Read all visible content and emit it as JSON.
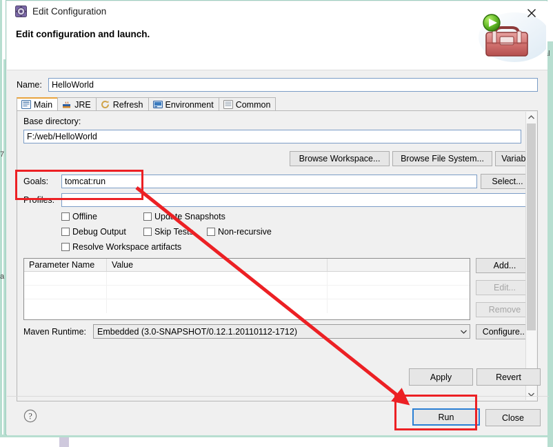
{
  "window": {
    "title": "Edit Configuration",
    "title_icon": "run-configuration-icon",
    "close_icon": "close-icon",
    "subtitle": "Edit configuration and launch.",
    "banner_icon": "maven-toolbox-run-icon"
  },
  "name_field": {
    "label": "Name:",
    "value": "HelloWorld"
  },
  "tabs": [
    {
      "label": "Main",
      "icon": "main-tab-icon",
      "active": true
    },
    {
      "label": "JRE",
      "icon": "jre-tab-icon",
      "active": false
    },
    {
      "label": "Refresh",
      "icon": "refresh-tab-icon",
      "active": false
    },
    {
      "label": "Environment",
      "icon": "environment-tab-icon",
      "active": false
    },
    {
      "label": "Common",
      "icon": "common-tab-icon",
      "active": false
    }
  ],
  "main_tab": {
    "base_directory": {
      "label": "Base directory:",
      "value": "F:/web/HelloWorld"
    },
    "browse_buttons": [
      "Browse Workspace...",
      "Browse File System...",
      "Variables..."
    ],
    "goals": {
      "label": "Goals:",
      "value": "tomcat:run",
      "button": "Select..."
    },
    "profiles": {
      "label": "Profiles:",
      "value": ""
    },
    "checkboxes": [
      {
        "label": "Offline",
        "checked": false
      },
      {
        "label": "Update Snapshots",
        "checked": false
      },
      {
        "label": "Debug Output",
        "checked": false
      },
      {
        "label": "Skip Tests",
        "checked": false
      },
      {
        "label": "Non-recursive",
        "checked": false
      },
      {
        "label": "Resolve Workspace artifacts",
        "checked": false
      }
    ],
    "parameter_table": {
      "headers": [
        "Parameter Name",
        "Value"
      ],
      "rows": []
    },
    "table_buttons": [
      {
        "label": "Add...",
        "enabled": true
      },
      {
        "label": "Edit...",
        "enabled": false
      },
      {
        "label": "Remove",
        "enabled": false
      }
    ],
    "maven_runtime": {
      "label": "Maven Runtime:",
      "value": "Embedded (3.0-SNAPSHOT/0.12.1.20110112-1712)",
      "button": "Configure..."
    },
    "scrollbar": {
      "up_icon": "chevron-up-icon",
      "down_icon": "chevron-down-icon"
    }
  },
  "footer": {
    "apply": "Apply",
    "revert": "Revert",
    "run": "Run",
    "close": "Close",
    "help_icon": "help-icon"
  },
  "annotations": {
    "highlight_color": "#ec2024",
    "goals_box": "highlight-goals-field",
    "run_box": "highlight-run-button",
    "arrow": "arrow-goals-to-run"
  },
  "backdrop": {
    "left_fragment_1": "7",
    "left_fragment_2": "a",
    "right_fragment_1": "al"
  }
}
